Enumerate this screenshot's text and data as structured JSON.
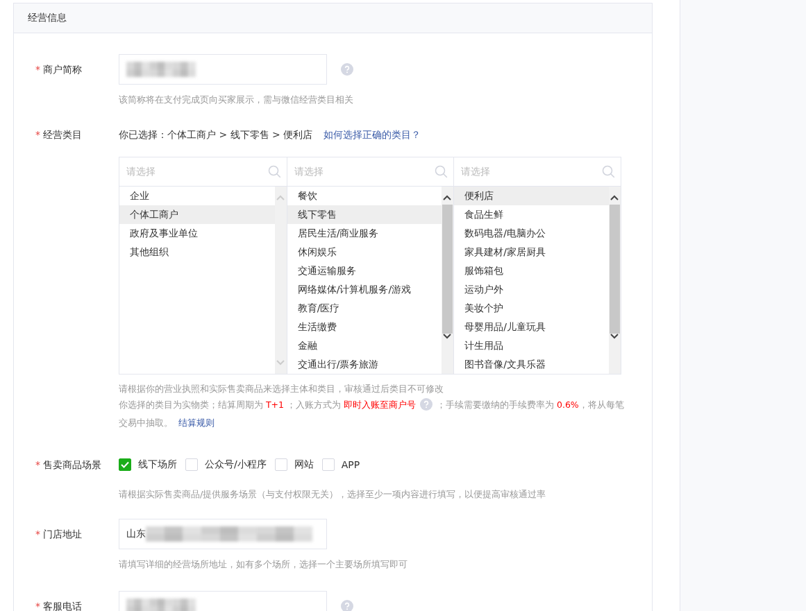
{
  "section": {
    "title": "经营信息"
  },
  "fields": [
    {
      "kind": "text",
      "marker": "*",
      "label": "商户简称",
      "blurred": true,
      "help": true,
      "hint": "该简称将在支付完成页向买家展示，需与微信经营类目相关"
    },
    {
      "kind": "category",
      "marker": "*",
      "label": "经营类目",
      "selection": "你已选择：个体工商户 > 线下零售 > 便利店",
      "link": "如何选择正确的类目？",
      "columns": [
        {
          "placeholder": "请选择",
          "scrollable": false,
          "items": [
            {
              "label": "企业",
              "selected": false
            },
            {
              "label": "个体工商户",
              "selected": true
            },
            {
              "label": "政府及事业单位",
              "selected": false
            },
            {
              "label": "其他组织",
              "selected": false
            }
          ]
        },
        {
          "placeholder": "请选择",
          "scrollable": true,
          "items": [
            {
              "label": "餐饮",
              "selected": false
            },
            {
              "label": "线下零售",
              "selected": true
            },
            {
              "label": "居民生活/商业服务",
              "selected": false
            },
            {
              "label": "休闲娱乐",
              "selected": false
            },
            {
              "label": "交通运输服务",
              "selected": false
            },
            {
              "label": "网络媒体/计算机服务/游戏",
              "selected": false
            },
            {
              "label": "教育/医疗",
              "selected": false
            },
            {
              "label": "生活缴费",
              "selected": false
            },
            {
              "label": "金融",
              "selected": false
            },
            {
              "label": "交通出行/票务旅游",
              "selected": false
            }
          ]
        },
        {
          "placeholder": "请选择",
          "scrollable": true,
          "items": [
            {
              "label": "便利店",
              "selected": true
            },
            {
              "label": "食品生鲜",
              "selected": false
            },
            {
              "label": "数码电器/电脑办公",
              "selected": false
            },
            {
              "label": "家具建材/家居厨具",
              "selected": false
            },
            {
              "label": "服饰箱包",
              "selected": false
            },
            {
              "label": "运动户外",
              "selected": false
            },
            {
              "label": "美妆个护",
              "selected": false
            },
            {
              "label": "母婴用品/儿童玩具",
              "selected": false
            },
            {
              "label": "计生用品",
              "selected": false
            },
            {
              "label": "图书音像/文具乐器",
              "selected": false
            }
          ]
        }
      ],
      "notes": [
        [
          {
            "kind": "plain",
            "text": "请根据你的营业执照和实际售卖商品来选择主体和类目，审核通过后类目不可修改"
          }
        ],
        [
          {
            "kind": "plain",
            "text": "你选择的类目为实物类；结算周期为 "
          },
          {
            "kind": "highlight",
            "text": "T+1"
          },
          {
            "kind": "plain",
            "text": " ；入账方式为 "
          },
          {
            "kind": "highlight",
            "text": "即时入账至商户号"
          },
          {
            "kind": "help"
          },
          {
            "kind": "plain",
            "text": "；手续需要缴纳的手续费率为 "
          },
          {
            "kind": "highlight",
            "text": "0.6%"
          },
          {
            "kind": "plain",
            "text": "，将从每笔交易中抽取。 "
          },
          {
            "kind": "link",
            "text": "结算规则"
          }
        ]
      ]
    },
    {
      "kind": "checkboxes",
      "marker": "*",
      "label": "售卖商品场景",
      "options": [
        {
          "label": "线下场所",
          "checked": true
        },
        {
          "label": "公众号/小程序",
          "checked": false
        },
        {
          "label": "网站",
          "checked": false
        },
        {
          "label": "APP",
          "checked": false
        }
      ],
      "hint": "请根据实际售卖商品/提供服务场景（与支付权限无关），选择至少一项内容进行填写，以便提高审核通过率"
    },
    {
      "kind": "text",
      "marker": "*",
      "label": "门店地址",
      "value": "山东",
      "blurred": true,
      "help": false,
      "hint": "请填写详细的经营场所地址，如有多个场所，选择一个主要场所填写即可"
    },
    {
      "kind": "text",
      "marker": "*",
      "label": "客服电话",
      "blurred": true,
      "help": true
    }
  ]
}
